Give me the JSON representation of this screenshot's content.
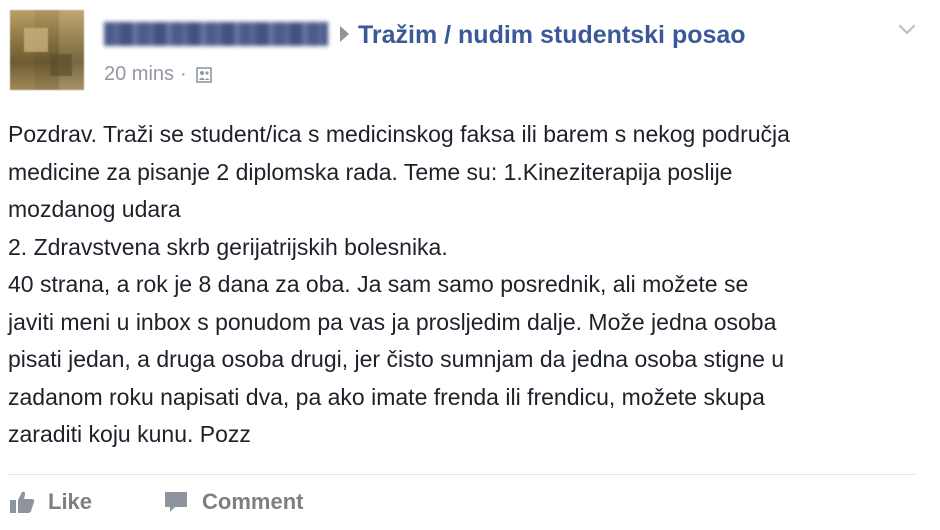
{
  "post": {
    "author_name": "",
    "group_name": "Tražim / nudim studentski posao",
    "timestamp": "20 mins",
    "meta_separator": "·",
    "privacy_icon": "group-members-icon",
    "body_lines": [
      "Pozdrav. Traži se student/ica s medicinskog faksa ili barem s nekog područja",
      "medicine za pisanje 2 diplomska rada. Teme su: 1.Kineziterapija poslije",
      "mozdanog udara",
      "2. Zdravstvena skrb gerijatrijskih bolesnika.",
      "40 strana, a rok je 8 dana za oba. Ja sam samo posrednik, ali možete se",
      "javiti meni u inbox s ponudom pa vas ja prosljedim dalje. Može jedna osoba",
      "pisati jedan, a druga osoba drugi, jer čisto sumnjam da jedna osoba stigne u",
      "zadanom roku napisati dva, pa ako imate frenda ili frendicu, možete skupa",
      "zaraditi koju kunu. Pozz"
    ]
  },
  "actions": {
    "like_label": "Like",
    "comment_label": "Comment"
  },
  "colors": {
    "link_blue": "#3b5998",
    "meta_gray": "#9197a3",
    "text": "#1d2129",
    "action_gray": "#7f7f7f"
  }
}
